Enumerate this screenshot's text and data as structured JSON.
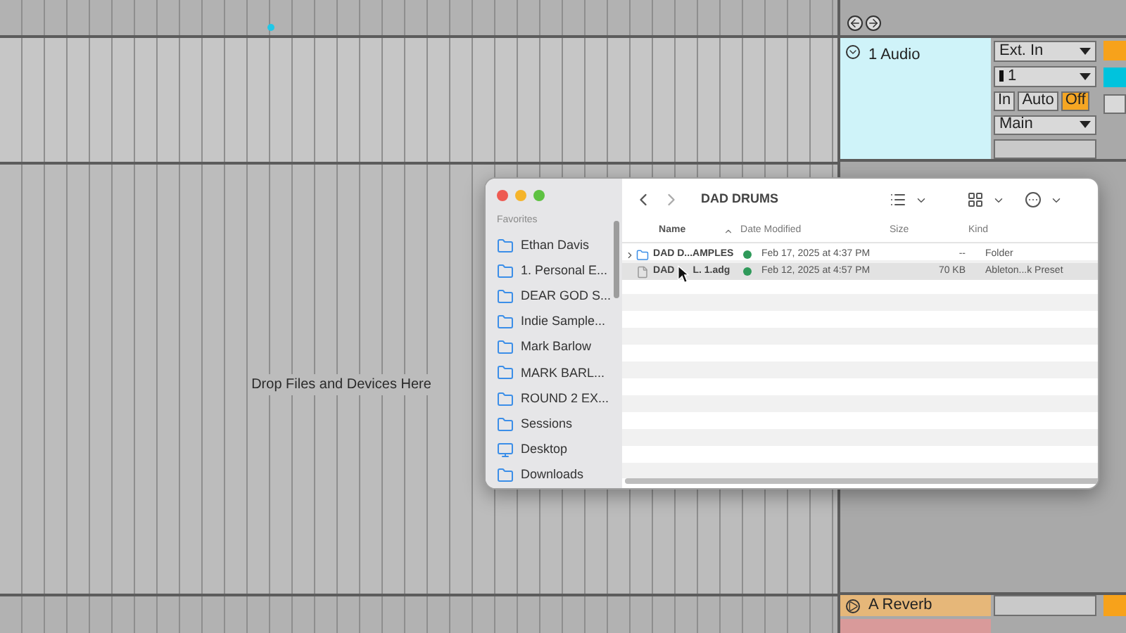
{
  "arrangement": {
    "drop_hint": "Drop Files and Devices Here"
  },
  "track": {
    "name": "1 Audio",
    "input_type": "Ext. In",
    "input_channel": "1",
    "monitor": [
      {
        "label": "In",
        "selected": false
      },
      {
        "label": "Auto",
        "selected": false
      },
      {
        "label": "Off",
        "selected": true
      }
    ],
    "output": "Main"
  },
  "return_track": {
    "name": "A Reverb"
  },
  "finder": {
    "title": "DAD DRUMS",
    "sidebar_heading": "Favorites",
    "sidebar_items": [
      "Ethan Davis",
      "1. Personal E...",
      "DEAR GOD S...",
      "Indie Sample...",
      "Mark Barlow",
      "MARK BARL...",
      "ROUND 2 EX...",
      "Sessions",
      "Desktop",
      "Downloads"
    ],
    "columns": [
      "Name",
      "Date Modified",
      "Size",
      "Kind"
    ],
    "rows": [
      {
        "kind": "folder",
        "name_parts": [
          "DAD D...AMPLES"
        ],
        "color": "#2f9a5a",
        "date": "Feb 17, 2025 at 4:37 PM",
        "size": "--",
        "type": "Folder",
        "selected": false
      },
      {
        "kind": "file",
        "name_parts": [
          "DAD",
          "L. 1.adg"
        ],
        "color": "#2f9a5a",
        "date": "Feb 12, 2025 at 4:57 PM",
        "size": "70 KB",
        "type": "Ableton...k Preset",
        "selected": true
      }
    ]
  }
}
